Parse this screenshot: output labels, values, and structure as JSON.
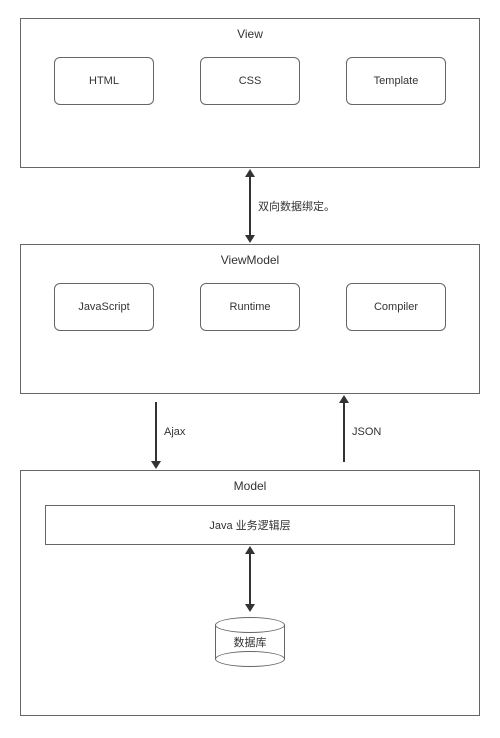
{
  "layers": {
    "view": {
      "title": "View",
      "boxes": [
        "HTML",
        "CSS",
        "Template"
      ]
    },
    "viewmodel": {
      "title": "ViewModel",
      "boxes": [
        "JavaScript",
        "Runtime",
        "Compiler"
      ]
    },
    "model": {
      "title": "Model",
      "logic_label": "Java 业务逻辑层",
      "db_label": "数据库"
    }
  },
  "connectors": {
    "view_vm": "双向数据绑定。",
    "vm_model_down": "Ajax",
    "vm_model_up": "JSON"
  },
  "watermark": ""
}
